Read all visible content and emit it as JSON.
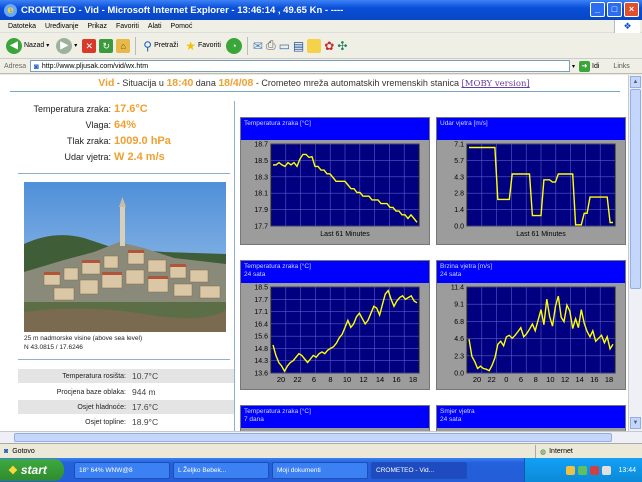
{
  "window": {
    "title": "CROMETEO - Vid - Microsoft Internet Explorer - 13:46:14 , 49.65 Kn - ----",
    "controls": [
      "_",
      "□",
      "×"
    ]
  },
  "menu": [
    "Datoteka",
    "Uređivanje",
    "Prikaz",
    "Favoriti",
    "Alati",
    "Pomoć"
  ],
  "toolbar": {
    "back": "Nazad",
    "search": "Pretraži",
    "favorites": "Favoriti"
  },
  "address": {
    "label": "Adresa",
    "url": "http://www.pljusak.com/vid/wx.htm",
    "go": "Idi",
    "links": "Links"
  },
  "page": {
    "header": {
      "station": "Vid",
      "t1": " - Situacija u ",
      "time": "18:40",
      "t2": " dana ",
      "date": "18/4/08",
      "t3": " - Crometeo mreža automatskih vremenskih stanica ",
      "moby": "[MOBY version]"
    },
    "current": [
      {
        "label": "Temperatura zraka:",
        "value": "17.6°C"
      },
      {
        "label": "Vlaga:",
        "value": "64%"
      },
      {
        "label": "Tlak zraka:",
        "value": "1009.0 hPa"
      },
      {
        "label": "Udar vjetra:",
        "value": "W 2.4 m/s"
      }
    ],
    "photo_caption": [
      "25 m nadmorske visine (above sea level)",
      "N 43.0815 / 17.6246"
    ],
    "derived": [
      {
        "label": "Temperatura rosišta:",
        "value": "10.7°C"
      },
      {
        "label": "Procjena baze oblaka:",
        "value": "944 m"
      },
      {
        "label": "Osjet hladnoće:",
        "value": "17.6°C"
      },
      {
        "label": "Osjet topline:",
        "value": "18.9°C"
      }
    ]
  },
  "colors": {
    "accent": "#f0a030",
    "chart_header": "#0000ff",
    "plot_bg": "#000080",
    "line": "#ffff00"
  },
  "status": {
    "left": "Gotovo",
    "zone": "Internet"
  },
  "taskbar": {
    "start": "start",
    "items": [
      "18° 64% WNW@8",
      "L Željko Bebek...",
      "Moji dokumenti",
      "CROMETEO - Vid..."
    ],
    "clock": "13:44"
  },
  "chart_data": [
    {
      "type": "line",
      "title": "Temperatura zraka [°C]",
      "subtitle": "",
      "xlabel": "Last 61 Minutes",
      "ylim": [
        17.7,
        18.8
      ],
      "y_ticks": [
        "18.7",
        "18.5",
        "18.3",
        "18.1",
        "17.9",
        "17.7"
      ],
      "x_ticks": [],
      "values": [
        18.52,
        18.52,
        18.55,
        18.52,
        18.5,
        18.55,
        18.52,
        18.55,
        18.5,
        18.6,
        18.66,
        18.66,
        18.62,
        18.63,
        18.5,
        18.5,
        18.45,
        18.45,
        18.4,
        18.4,
        18.35,
        18.3,
        18.3,
        18.3,
        18.3,
        18.25,
        18.2,
        18.2,
        18.15,
        18.15,
        18.1,
        18.1,
        18.1,
        18.05,
        18.05,
        18.05,
        18.0,
        18.0,
        18.0,
        17.95,
        17.95,
        17.9,
        17.9,
        17.85,
        17.85,
        17.8,
        17.85,
        17.8,
        17.75
      ]
    },
    {
      "type": "line",
      "title": "Udar vjetra [m/s]",
      "subtitle": "",
      "xlabel": "Last 61 Minutes",
      "ylim": [
        0.0,
        7.1
      ],
      "y_ticks": [
        "7.1",
        "5.7",
        "4.3",
        "2.8",
        "1.4",
        "0.0"
      ],
      "x_ticks": [],
      "values": [
        6.8,
        6.8,
        6.8,
        6.8,
        6.8,
        6.8,
        6.8,
        6.8,
        6.8,
        6.8,
        2.3,
        2.3,
        2.3,
        2.3,
        2.3,
        4.5,
        4.5,
        4.5,
        4.5,
        4.5,
        4.5,
        4.5,
        0.9,
        0.9,
        0.9,
        0.9,
        4.0,
        4.0,
        4.0,
        3.8,
        3.8,
        4.5,
        4.5,
        4.5,
        4.5,
        4.5,
        4.5,
        0.1,
        0.1,
        0.1,
        1.1,
        1.1,
        2.5,
        2.5,
        2.5,
        2.5,
        2.5,
        2.5,
        2.5,
        0.3,
        0.3
      ]
    },
    {
      "type": "line",
      "title": "Temperatura zraka [°C]",
      "subtitle": "24 sata",
      "xlabel": "",
      "ylim": [
        13.6,
        18.5
      ],
      "y_ticks": [
        "18.5",
        "17.7",
        "17.1",
        "16.4",
        "15.6",
        "14.8",
        "14.3",
        "13.6"
      ],
      "x_ticks": [
        "20",
        "22",
        "6",
        "8",
        "10",
        "12",
        "14",
        "16",
        "18"
      ],
      "values": [
        15.2,
        14.6,
        14.2,
        14.0,
        13.7,
        14.0,
        14.2,
        14.3,
        14.5,
        14.7,
        14.6,
        14.4,
        14.2,
        14.4,
        14.6,
        14.5,
        14.7,
        14.8,
        14.7,
        14.9,
        15.0,
        15.1,
        15.3,
        15.6,
        15.8,
        16.2,
        16.6,
        16.2,
        16.4,
        16.8,
        17.0,
        16.7,
        16.4,
        16.6,
        17.0,
        17.4,
        17.3,
        16.9,
        17.5,
        18.1,
        18.3,
        17.8,
        17.4,
        17.7,
        17.9,
        18.0,
        17.8,
        17.9,
        18.0,
        17.7,
        17.6
      ]
    },
    {
      "type": "line",
      "title": "Brzina vjetra [m/s]",
      "subtitle": "24 sata",
      "xlabel": "",
      "ylim": [
        0.0,
        11.4
      ],
      "y_ticks": [
        "11.4",
        "9.1",
        "6.8",
        "4.6",
        "2.3",
        "0.0"
      ],
      "x_ticks": [
        "20",
        "22",
        "0",
        "6",
        "8",
        "10",
        "12",
        "14",
        "16",
        "18"
      ],
      "values": [
        4.5,
        2.2,
        1.5,
        0.6,
        0.9,
        0.6,
        0.5,
        0.3,
        1.0,
        2.0,
        3.8,
        4.2,
        3.6,
        4.8,
        5.0,
        4.6,
        5.0,
        5.5,
        6.0,
        4.8,
        5.2,
        5.8,
        6.5,
        5.6,
        7.0,
        8.4,
        6.4,
        9.8,
        7.5,
        6.2,
        8.8,
        10.2,
        7.4,
        6.8,
        9.0,
        8.2,
        5.9,
        7.2,
        6.0,
        8.4,
        6.6,
        5.5,
        4.8,
        5.6,
        4.2,
        4.6,
        5.0,
        4.0,
        4.8,
        3.2,
        3.8
      ]
    },
    {
      "type": "line",
      "title": "Temperatura zraka [°C]",
      "subtitle": "7 dana",
      "values": []
    },
    {
      "type": "line",
      "title": "Smjer vjetra",
      "subtitle": "24 sata",
      "values": []
    }
  ]
}
